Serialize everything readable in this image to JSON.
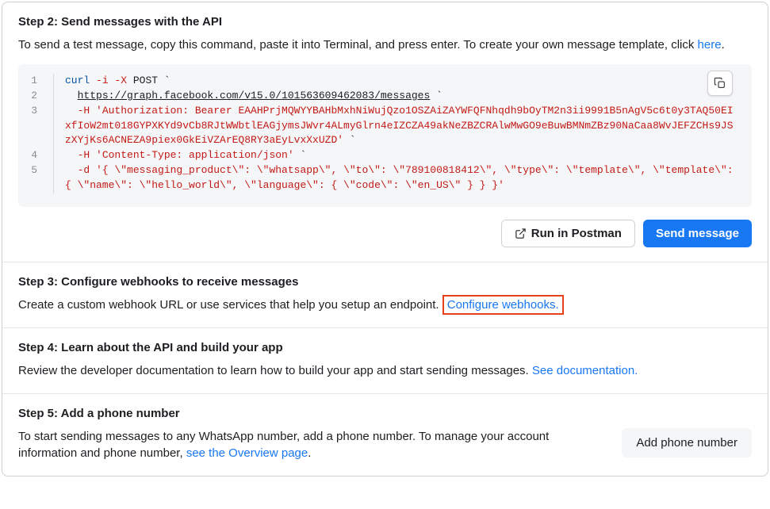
{
  "step2": {
    "title": "Step 2: Send messages with the API",
    "desc_prefix": "To send a test message, copy this command, paste it into Terminal, and press enter. To create your own message template, click ",
    "desc_link": "here",
    "desc_suffix": ".",
    "code": {
      "line1": {
        "cmd": "curl",
        "flag1": "-i",
        "flag2": "-X",
        "method": "POST",
        "backtick": "`"
      },
      "line2": {
        "indent": "  ",
        "url": "https://graph.facebook.com/v15.0/101563609462083/messages",
        "backtick": " `"
      },
      "line3": {
        "indent": "  ",
        "content": "-H 'Authorization: Bearer EAAHPrjMQWYYBAHbMxhNiWujQzo1OSZAiZAYWFQFNhqdh9bOyTM2n3ii9991B5nAgV5c6t0y3TAQ50EIxfIoW2mt018GYPXKYd9vCb8RJtWWbtlEAGjymsJWvr4ALmyGlrn4eIZCZA49akNeZBZCRAlwMwGO9eBuwBMNmZBz90NaCaa8WvJEFZCHs9JSzXYjKs6ACNEZA9piex0GkEiVZArEQ8RY3aEyLvxXxUZD'",
        "backtick": " `"
      },
      "line4": {
        "indent": "  ",
        "content": "-H 'Content-Type: application/json'",
        "backtick": " `"
      },
      "line5": {
        "indent": "  ",
        "content": "-d '{ \\\"messaging_product\\\": \\\"whatsapp\\\", \\\"to\\\": \\\"789100818412\\\", \\\"type\\\": \\\"template\\\", \\\"template\\\": { \\\"name\\\": \\\"hello_world\\\", \\\"language\\\": { \\\"code\\\": \\\"en_US\\\" } } }'"
      }
    },
    "run_postman": "Run in Postman",
    "send_message": "Send message"
  },
  "step3": {
    "title": "Step 3: Configure webhooks to receive messages",
    "desc_prefix": "Create a custom webhook URL or use services that help you setup an endpoint. ",
    "link": "Configure webhooks."
  },
  "step4": {
    "title": "Step 4: Learn about the API and build your app",
    "desc_prefix": "Review the developer documentation to learn how to build your app and start sending messages. ",
    "link": "See documentation."
  },
  "step5": {
    "title": "Step 5: Add a phone number",
    "desc_prefix": "To start sending messages to any WhatsApp number, add a phone number. To manage your account information and phone number, ",
    "link": "see the Overview page",
    "desc_suffix": ".",
    "button": "Add phone number"
  }
}
